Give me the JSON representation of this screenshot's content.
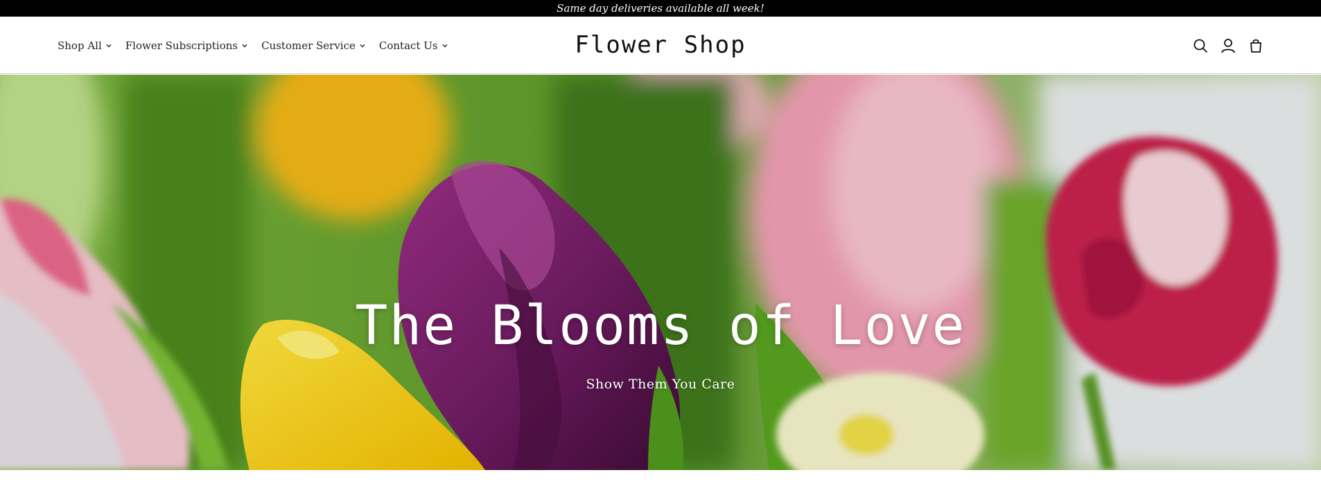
{
  "announcement": {
    "text": "Same day deliveries available all week!"
  },
  "header": {
    "nav": [
      {
        "label": "Shop All",
        "icon": "chevron-down-icon"
      },
      {
        "label": "Flower Subscriptions",
        "icon": "chevron-down-icon"
      },
      {
        "label": "Customer Service",
        "icon": "chevron-down-icon"
      },
      {
        "label": "Contact Us",
        "icon": "chevron-down-icon"
      }
    ],
    "logo": "Flower Shop",
    "icons": [
      "search-icon",
      "account-icon",
      "cart-icon"
    ]
  },
  "hero": {
    "title": "The Blooms of Love",
    "subtitle": "Show Them You Care"
  },
  "colors": {
    "announcement_bg": "#000000",
    "announcement_text": "#ffffff",
    "header_bg": "#ffffff",
    "text": "#222222",
    "hero_text": "#ffffff"
  }
}
